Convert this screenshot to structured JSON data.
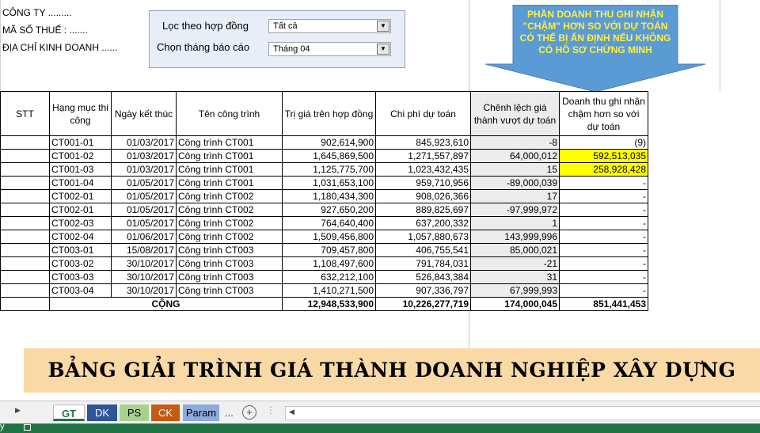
{
  "company": {
    "name_line": "CÔNG TY .........",
    "tax_line": "MÃ SỐ THUẾ : .......",
    "address_line": "ĐỊA CHỈ KINH DOANH ......"
  },
  "filters": {
    "contract_label": "Lọc theo hợp đồng",
    "contract_value": "Tất cả",
    "month_label": "Chọn tháng báo cáo",
    "month_value": "Tháng 04"
  },
  "callout": {
    "lines": [
      "PHẦN DOANH THU GHI NHẬN",
      "\"CHẬM\" HƠN SO VỚI DỰ TOÁN",
      "CÓ THỂ BỊ ẤN ĐỊNH NẾU KHÔNG",
      "CÓ HỒ SƠ CHỨNG MINH"
    ],
    "color": "#5b9bd5",
    "text_color": "#ffef3f"
  },
  "table": {
    "headers": [
      "STT",
      "Hạng mục thi công",
      "Ngày kết thúc",
      "Tên công trình",
      "Trị giá trên hợp đồng",
      "Chi phí dự toán",
      "Chênh lệch giá thành vượt dự toán",
      "Doanh thu ghi nhận chậm hơn so với dự toán"
    ],
    "rows": [
      {
        "code": "CT001-01",
        "date": "01/03/2017",
        "project": "Công trình CT001",
        "contract": "902,614,900",
        "cost": "845,923,610",
        "diff": "-8",
        "late": "(9)",
        "highlight": false
      },
      {
        "code": "CT001-02",
        "date": "01/03/2017",
        "project": "Công trình CT001",
        "contract": "1,645,869,500",
        "cost": "1,271,557,897",
        "diff": "64,000,012",
        "late": "592,513,035",
        "highlight": true
      },
      {
        "code": "CT001-03",
        "date": "01/03/2017",
        "project": "Công trình CT001",
        "contract": "1,125,775,700",
        "cost": "1,023,432,435",
        "diff": "15",
        "late": "258,928,428",
        "highlight": true
      },
      {
        "code": "CT001-04",
        "date": "01/05/2017",
        "project": "Công trình CT001",
        "contract": "1,031,653,100",
        "cost": "959,710,956",
        "diff": "-89,000,039",
        "late": "-",
        "highlight": false
      },
      {
        "code": "CT002-01",
        "date": "01/05/2017",
        "project": "Công trình CT002",
        "contract": "1,180,434,300",
        "cost": "908,026,366",
        "diff": "17",
        "late": "-",
        "highlight": false
      },
      {
        "code": "CT002-01",
        "date": "01/05/2017",
        "project": "Công trình CT002",
        "contract": "927,650,200",
        "cost": "889,825,697",
        "diff": "-97,999,972",
        "late": "-",
        "highlight": false
      },
      {
        "code": "CT002-03",
        "date": "01/05/2017",
        "project": "Công trình CT002",
        "contract": "764,640,400",
        "cost": "637,200,332",
        "diff": "1",
        "late": "-",
        "highlight": false
      },
      {
        "code": "CT002-04",
        "date": "01/06/2017",
        "project": "Công trình CT002",
        "contract": "1,509,456,800",
        "cost": "1,057,880,673",
        "diff": "143,999,996",
        "late": "-",
        "highlight": false
      },
      {
        "code": "CT003-01",
        "date": "15/08/2017",
        "project": "Công trình CT003",
        "contract": "709,457,800",
        "cost": "406,755,541",
        "diff": "85,000,021",
        "late": "-",
        "highlight": false
      },
      {
        "code": "CT003-02",
        "date": "30/10/2017",
        "project": "Công trình CT003",
        "contract": "1,108,497,600",
        "cost": "791,784,031",
        "diff": "-21",
        "late": "-",
        "highlight": false
      },
      {
        "code": "CT003-03",
        "date": "30/10/2017",
        "project": "Công trình CT003",
        "contract": "632,212,100",
        "cost": "526,843,384",
        "diff": "31",
        "late": "-",
        "highlight": false
      },
      {
        "code": "CT003-04",
        "date": "30/10/2017",
        "project": "Công trình CT003",
        "contract": "1,410,271,500",
        "cost": "907,336,797",
        "diff": "67,999,993",
        "late": "-",
        "highlight": false
      }
    ],
    "total": {
      "label": "CỘNG",
      "contract": "12,948,533,900",
      "cost": "10,226,277,719",
      "diff": "174,000,045",
      "late": "851,441,453"
    }
  },
  "banner": {
    "title": "BẢNG GIẢI TRÌNH GIÁ THÀNH DOANH NGHIỆP XÂY DỰNG",
    "color": "#f9d9a6"
  },
  "sheet_tabs": [
    {
      "label": "GT",
      "active": true,
      "color": "#ffffff"
    },
    {
      "label": "DK",
      "active": false,
      "color": "#2f5597"
    },
    {
      "label": "PS",
      "active": false,
      "color": "#a9d18e"
    },
    {
      "label": "CK",
      "active": false,
      "color": "#c55a11"
    },
    {
      "label": "Param",
      "active": false,
      "color": "#8faadc"
    }
  ],
  "tab_overflow": "...",
  "status_text": "y"
}
